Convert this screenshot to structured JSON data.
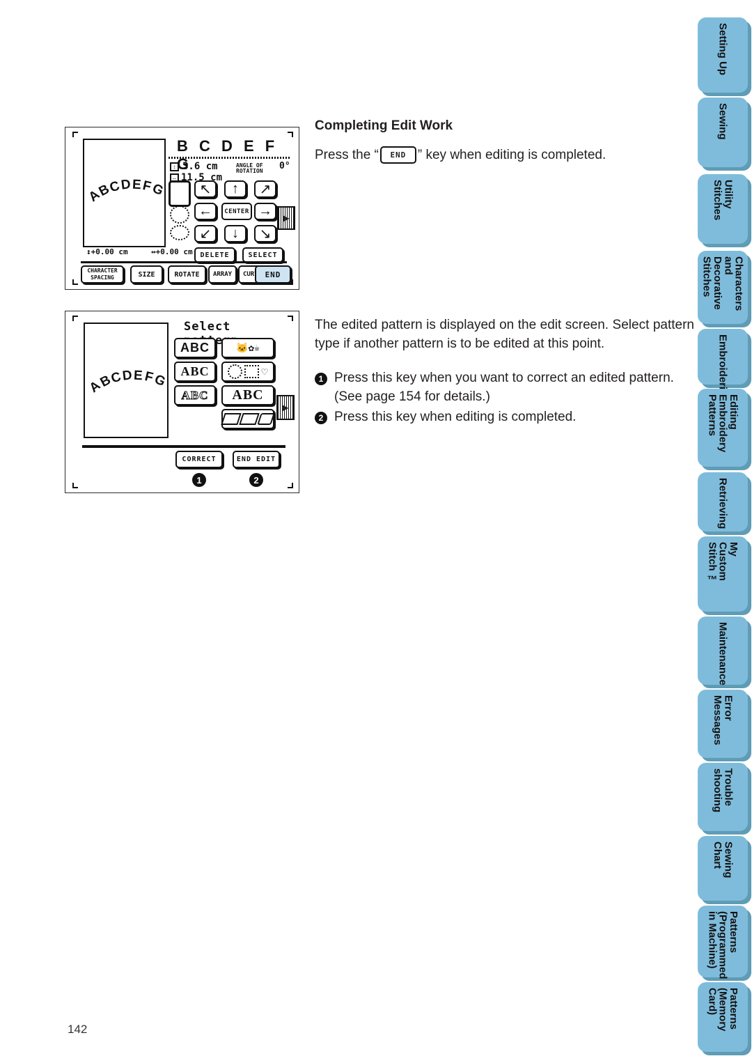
{
  "page": {
    "number": "142"
  },
  "content": {
    "heading": "Completing Edit Work",
    "press_prefix": "Press the “",
    "press_key": "END",
    "press_suffix": "” key when editing is completed.",
    "paragraph": "The edited pattern is displayed on the edit screen. Select pattern type if another pattern is to be edited at this point.",
    "items": [
      {
        "bullet": "1",
        "line1": "Press this key when you want to correct an edited pattern.",
        "line2": "(See page 154 for details.)"
      },
      {
        "bullet": "2",
        "line1": "Press this key when editing is completed.",
        "line2": ""
      }
    ]
  },
  "figure_edit": {
    "title_chars": "B C D E F G",
    "preview_text": "ABCDEFG",
    "size_height": "3.6 cm",
    "size_width": "11.5 cm",
    "angle_label_line1": "ANGLE OF",
    "angle_label_line2": "ROTATION",
    "angle_value": "0°",
    "offset_vertical": "+0.00 cm",
    "offset_horizontal": "+0.00 cm",
    "center_key": "CENTER",
    "delete_key": "DELETE",
    "select_key": "SELECT",
    "bottom_keys": [
      {
        "label": "CHARACTER\nSPACING",
        "line1": "CHARACTER",
        "line2": "SPACING"
      },
      {
        "label": "SIZE",
        "line1": "SIZE",
        "line2": ""
      },
      {
        "label": "ROTATE",
        "line1": "ROTATE",
        "line2": ""
      },
      {
        "label": "ARRAY",
        "line1": "ARRAY",
        "line2": ""
      },
      {
        "label": "CURVE",
        "line1": "CURVE",
        "line2": ""
      }
    ],
    "end_key": "END",
    "arrows": [
      "↖",
      "↑",
      "↗",
      "←",
      "CENTER",
      "→",
      "↙",
      "↓",
      "↘"
    ]
  },
  "figure_select": {
    "title": "Select pattern.",
    "preview_text": "ABCDEFG",
    "pattern_keys": [
      {
        "name": "abc-block-font",
        "label": "ABC"
      },
      {
        "name": "animal-flower-cup-patterns",
        "label": ""
      },
      {
        "name": "abc-outline-font",
        "label": "ABC"
      },
      {
        "name": "frame-patterns",
        "label": ""
      },
      {
        "name": "abc-shadow-font",
        "label": "ABC"
      },
      {
        "name": "abc-floral-alphabet",
        "label": "ABC"
      },
      {
        "name": "memory-card-patterns",
        "label": ""
      }
    ],
    "correct_key": "CORRECT",
    "end_edit_key": "END EDIT",
    "callouts": [
      "1",
      "2"
    ]
  },
  "sidebar": {
    "accent_color": "#7fbcdc",
    "shadow_color": "#5f9cb5",
    "tabs": [
      {
        "name": "setting-up",
        "label": "Setting Up"
      },
      {
        "name": "sewing",
        "label": "Sewing"
      },
      {
        "name": "utility-stitches",
        "label": "Utility\nStitches"
      },
      {
        "name": "characters-and-decorative-stitches",
        "label": "Characters\nand\nDecorative\nStitches"
      },
      {
        "name": "embroidering",
        "label": "Embroidering"
      },
      {
        "name": "editing-embroidery-patterns",
        "label": "Editing\nEmbroidery\nPatterns"
      },
      {
        "name": "retrieving",
        "label": "Retrieving"
      },
      {
        "name": "my-custom-stitch",
        "label": "My\nCustom\nStitch ™"
      },
      {
        "name": "maintenance",
        "label": "Maintenance"
      },
      {
        "name": "error-messages",
        "label": "Error\nMessages"
      },
      {
        "name": "troubleshooting",
        "label": "Trouble\nshooting"
      },
      {
        "name": "sewing-chart",
        "label": "Sewing\nChart"
      },
      {
        "name": "patterns-programmed-in-machine",
        "label": "Patterns\n(Programmed\nin Machine)"
      },
      {
        "name": "patterns-memory-card",
        "label": "Patterns\n(Memory\nCard)"
      }
    ]
  }
}
